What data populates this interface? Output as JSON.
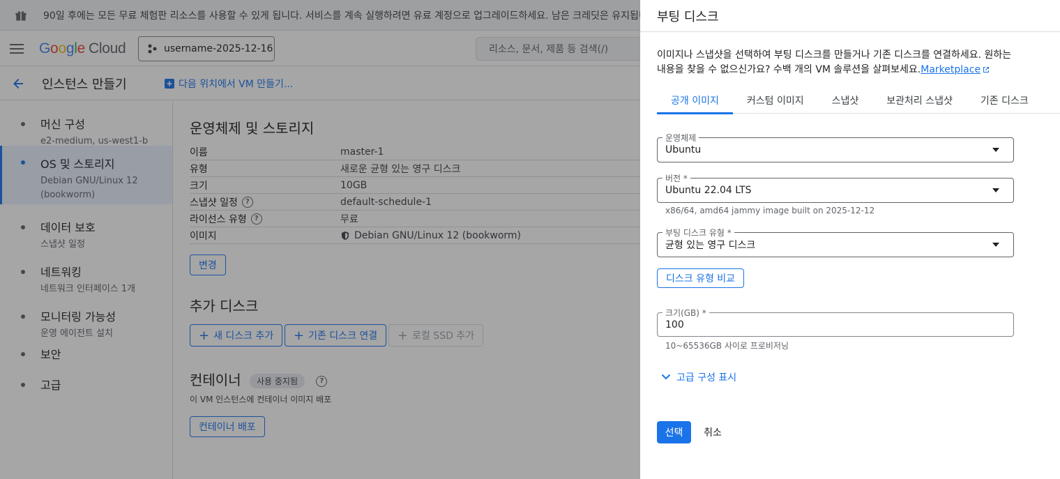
{
  "banner": {
    "text": "90일 후에는 모든 무료 체험판 리소스를 사용할 수 있게 됩니다. 서비스를 계속 실행하려면 유료 계정으로 업그레이드하세요. 남은 크레딧은 유지됩니다."
  },
  "header": {
    "logo_google": [
      "G",
      "o",
      "o",
      "g",
      "l",
      "e"
    ],
    "logo_cloud": "Cloud",
    "project": "username-2025-12-16",
    "search_placeholder": "리소스, 문서, 제품 등 검색(/)"
  },
  "page": {
    "title": "인스턴스 만들기",
    "create_at": "다음 위치에서 VM 만들기..."
  },
  "sidebar": {
    "items": [
      {
        "title": "머신 구성",
        "sub": "e2-medium, us-west1-b"
      },
      {
        "title": "OS 및 스토리지",
        "sub": "Debian GNU/Linux 12 (bookworm)"
      },
      {
        "title": "데이터 보호",
        "sub": "스냅샷 일정"
      },
      {
        "title": "네트워킹",
        "sub": "네트워크 인터페이스 1개"
      },
      {
        "title": "모니터링 가능성",
        "sub": "운영 에이전트 설치"
      },
      {
        "title": "보안",
        "sub": ""
      },
      {
        "title": "고급",
        "sub": ""
      }
    ]
  },
  "main": {
    "os_section_title": "운영체제 및 스토리지",
    "rows": [
      {
        "key": "이름",
        "value": "master-1"
      },
      {
        "key": "유형",
        "value": "새로운 균형 있는 영구 디스크"
      },
      {
        "key": "크기",
        "value": "10GB"
      },
      {
        "key": "스냅샷 일정",
        "value": "default-schedule-1"
      },
      {
        "key": "라이선스 유형",
        "value": "무료"
      },
      {
        "key": "이미지",
        "value": "Debian GNU/Linux 12 (bookworm)"
      }
    ],
    "change_button": "변경",
    "additional_disks_title": "추가 디스크",
    "add_new_disk": "새 디스크 추가",
    "attach_existing_disk": "기존 디스크 연결",
    "add_local_ssd": "로컬 SSD 추가",
    "container_title": "컨테이너",
    "deprecated_chip": "사용 중지됨",
    "container_sub": "이 VM 인스턴스에 컨테이너 이미지 배포",
    "deploy_container": "컨테이너 배포"
  },
  "drawer": {
    "title": "부팅 디스크",
    "description": "이미지나 스냅샷을 선택하여 부팅 디스크를 만들거나 기존 디스크를 연결하세요. 원하는 내용을 찾을 수 없으신가요? 수백 개의 VM 솔루션을 살펴보세요.",
    "marketplace_link": "Marketplace",
    "tabs": [
      "공개 이미지",
      "커스텀 이미지",
      "스냅샷",
      "보관처리 스냅샷",
      "기존 디스크"
    ],
    "active_tab": 0,
    "os_label": "운영체제",
    "os_value": "Ubuntu",
    "version_label": "버전 *",
    "version_value": "Ubuntu 22.04 LTS",
    "version_hint": "x86/64, amd64 jammy image built on 2025-12-12",
    "disk_type_label": "부팅 디스크 유형 *",
    "disk_type_value": "균형 있는 영구 디스크",
    "compare_button": "디스크 유형 비교",
    "size_label": "크기(GB) *",
    "size_value": "100",
    "size_hint": "10~65536GB 사이로 프로비저닝",
    "advanced_toggle": "고급 구성 표시",
    "select_button": "선택",
    "cancel_button": "취소"
  },
  "colors": {
    "accent": "#1a73e8",
    "scrim": "rgba(32,33,36,0.4)",
    "text": "#202124"
  }
}
